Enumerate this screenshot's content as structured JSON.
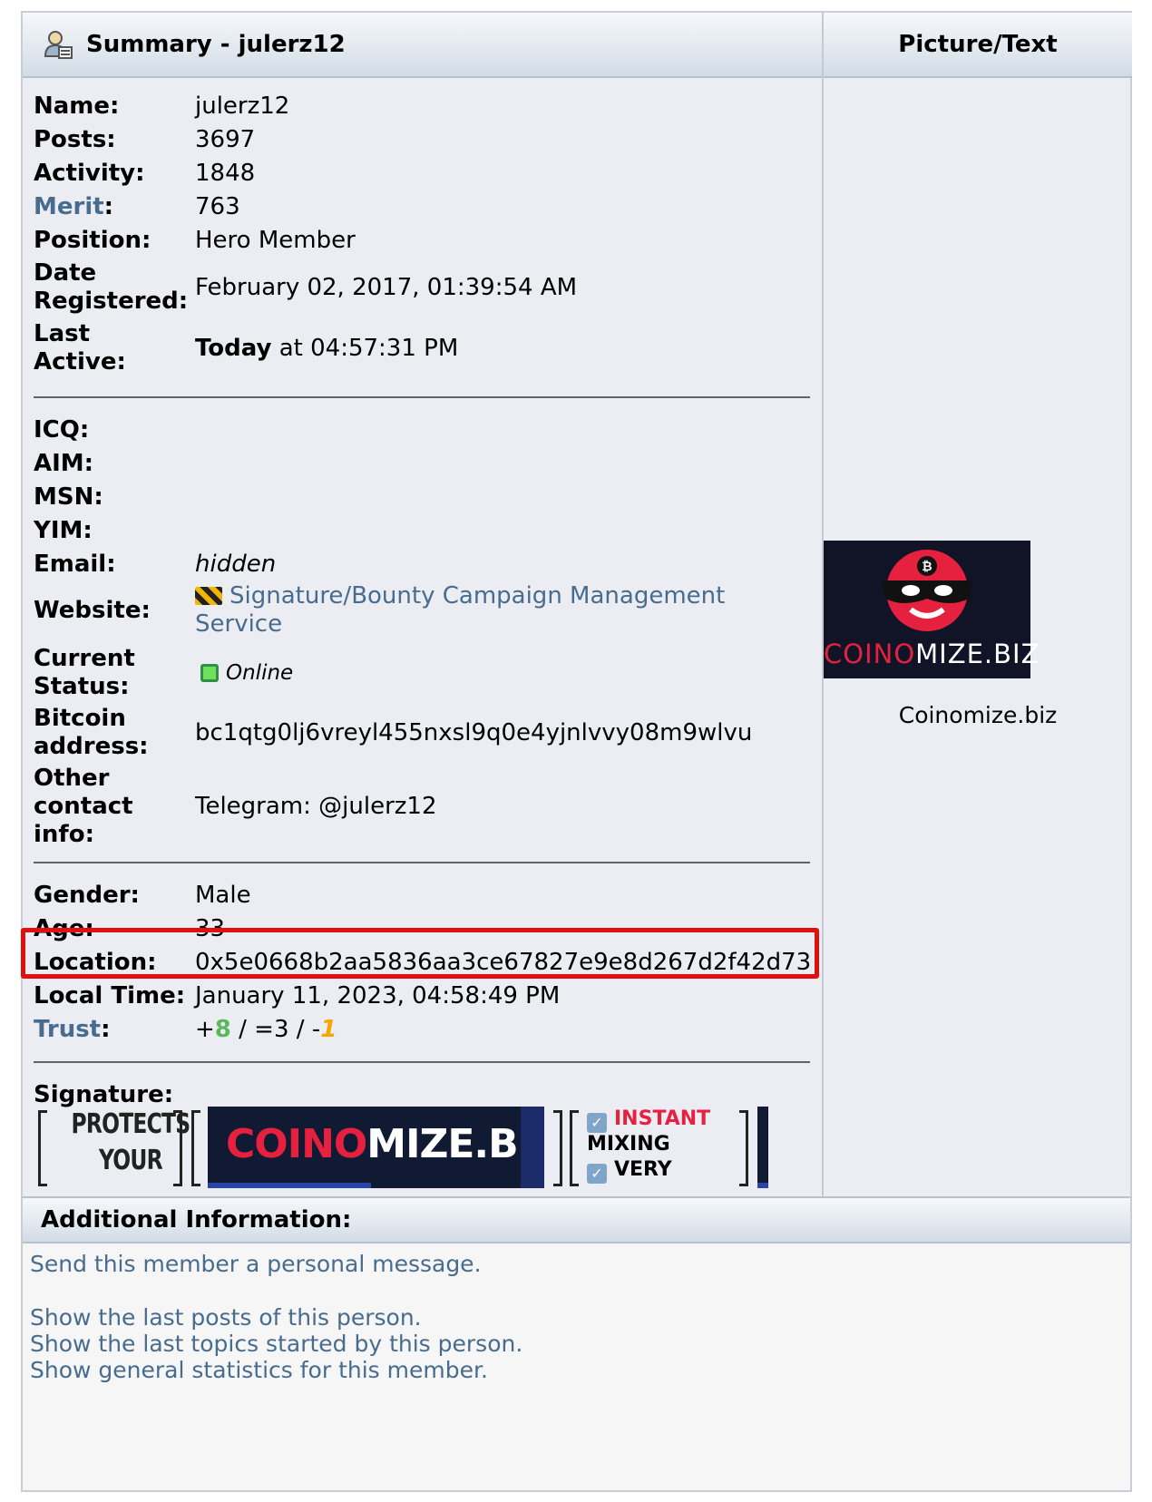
{
  "summary_header": "Summary - julerz12",
  "picture_header": "Picture/Text",
  "profile": {
    "name_label": "Name:",
    "name": "julerz12",
    "posts_label": "Posts:",
    "posts": "3697",
    "activity_label": "Activity:",
    "activity": "1848",
    "merit_label": "Merit",
    "merit": "763",
    "position_label": "Position:",
    "position": "Hero Member",
    "registered_label_1": "Date",
    "registered_label_2": "Registered:",
    "registered": "February 02, 2017, 01:39:54 AM",
    "last_active_label_1": "Last",
    "last_active_label_2": "Active:",
    "last_active_bold": "Today",
    "last_active_rest": " at 04:57:31 PM",
    "icq_label": "ICQ:",
    "aim_label": "AIM:",
    "msn_label": "MSN:",
    "yim_label": "YIM:",
    "email_label": "Email:",
    "email": "hidden",
    "website_label": "Website:",
    "website_line1": "Signature/Bounty Campaign Management",
    "website_line2": "Service",
    "status_label_1": "Current",
    "status_label_2": "Status:",
    "status": "Online",
    "bitcoin_label_1": "Bitcoin",
    "bitcoin_label_2": "address:",
    "bitcoin": "bc1qtg0lj6vreyl455nxsl9q0e4yjnlvvy08m9wlvu",
    "other_label_1": "Other",
    "other_label_2": "contact",
    "other_label_3": "info:",
    "other": "Telegram: @julerz12",
    "gender_label": "Gender:",
    "gender": "Male",
    "age_label": "Age:",
    "age": "33",
    "location_label": "Location:",
    "location": "0x5e0668b2aa5836aa3ce67827e9e8d267d2f42d73",
    "local_time_label": "Local Time:",
    "local_time": "January 11, 2023, 04:58:49 PM",
    "trust_label": "Trust",
    "trust_pos": "8",
    "trust_neutral": "3",
    "trust_neg": "1",
    "signature_label": "Signature:"
  },
  "signature": {
    "protects_1": "PROTECTS",
    "protects_2": "YOUR",
    "banner_red": "COINO",
    "banner_white": "MIZE.BIZ",
    "feat_1": "INSTANT",
    "feat_2": "MIXING",
    "feat_3": "VERY"
  },
  "avatar": {
    "brand_left": "COINO",
    "brand_right": "MIZE.BIZ",
    "caption": "Coinomize.biz"
  },
  "additional": {
    "header": "Additional Information:",
    "pm_link": "Send this member a personal message.",
    "posts_link": "Show the last posts of this person.",
    "topics_link": "Show the last topics started by this person.",
    "stats_link": "Show general statistics for this member."
  },
  "colors": {
    "link": "#476c8e",
    "highlight": "#e01010",
    "trust_pos": "#5cb85c",
    "trust_neg": "#f7a600"
  }
}
